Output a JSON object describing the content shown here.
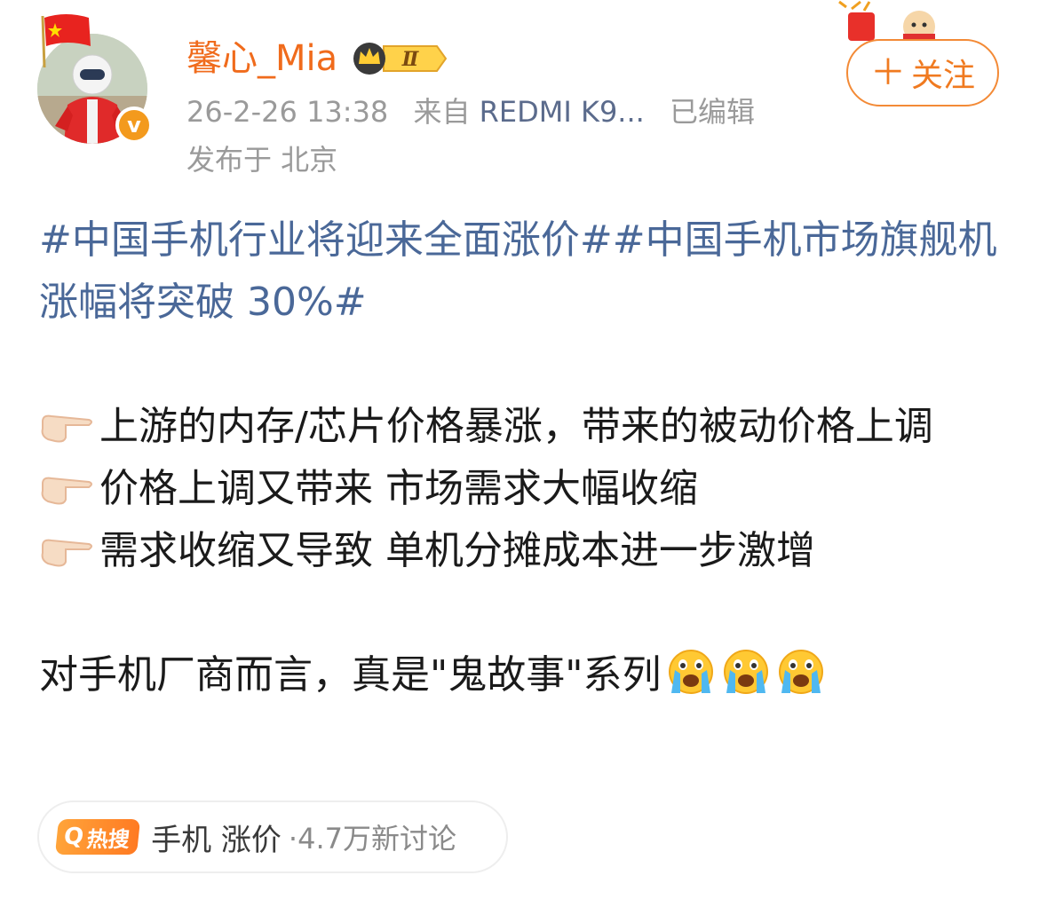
{
  "user": {
    "name": "馨心_Mia",
    "vip_level": "Ⅱ",
    "verified_mark": "v",
    "avatar_icon": "avatar-racer",
    "flag_icon": "china-flag-icon"
  },
  "meta": {
    "time": "26-2-26 13:38",
    "source_prefix": "来自",
    "device": "REDMI K9...",
    "edited": "已编辑",
    "location": "发布于 北京"
  },
  "follow": {
    "plus": "＋",
    "label": "关注"
  },
  "post": {
    "topic": "#中国手机行业将迎来全面涨价##中国手机市场旗舰机涨幅将突破 30%#",
    "bullets": [
      "上游的内存/芯片价格暴涨，带来的被动价格上调",
      "价格上调又带来 市场需求大幅收缩",
      "需求收缩又导致 单机分摊成本进一步激增"
    ],
    "closing": "对手机厂商而言，真是\"鬼故事\"系列",
    "emojis": [
      "crying-face-emoji",
      "crying-face-emoji",
      "crying-face-emoji"
    ],
    "bullet_icon": "pointing-hand-icon"
  },
  "hot_search": {
    "tag_icon": "search-icon",
    "tag_label": "热搜",
    "keywords": "手机 涨价",
    "count": "·4.7万新讨论"
  },
  "colors": {
    "username": "#f06b1c",
    "topic": "#4a6898",
    "follow": "#f07a20",
    "meta": "#9a9a9a",
    "device": "#5b6b8c"
  }
}
